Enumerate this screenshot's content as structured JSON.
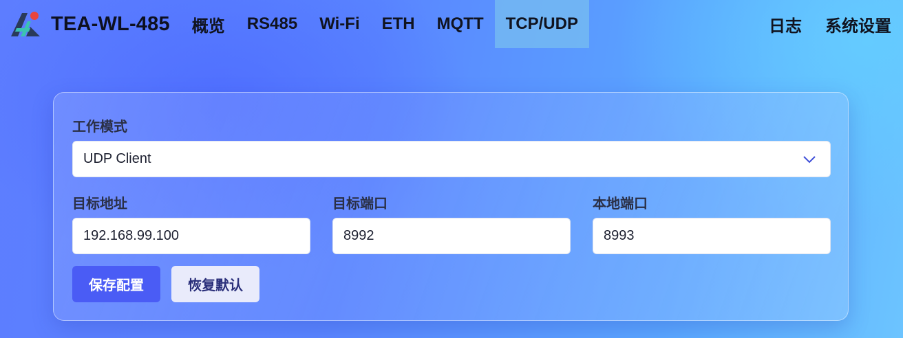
{
  "brand": {
    "name": "TEA-WL-485",
    "logo_icon": "tea-logo-icon"
  },
  "nav": {
    "items": [
      {
        "label": "概览"
      },
      {
        "label": "RS485"
      },
      {
        "label": "Wi-Fi"
      },
      {
        "label": "ETH"
      },
      {
        "label": "MQTT"
      },
      {
        "label": "TCP/UDP",
        "active": true
      }
    ],
    "right": [
      {
        "label": "日志"
      },
      {
        "label": "系统设置"
      }
    ]
  },
  "form": {
    "mode_label": "工作模式",
    "mode_value": "UDP Client",
    "target_addr_label": "目标地址",
    "target_addr_value": "192.168.99.100",
    "target_port_label": "目标端口",
    "target_port_value": "8992",
    "local_port_label": "本地端口",
    "local_port_value": "8993",
    "save_label": "保存配置",
    "reset_label": "恢复默认"
  },
  "colors": {
    "accent": "#4a5cf5",
    "active_tab": "#78bef0",
    "logo_dot": "#e8453c"
  }
}
